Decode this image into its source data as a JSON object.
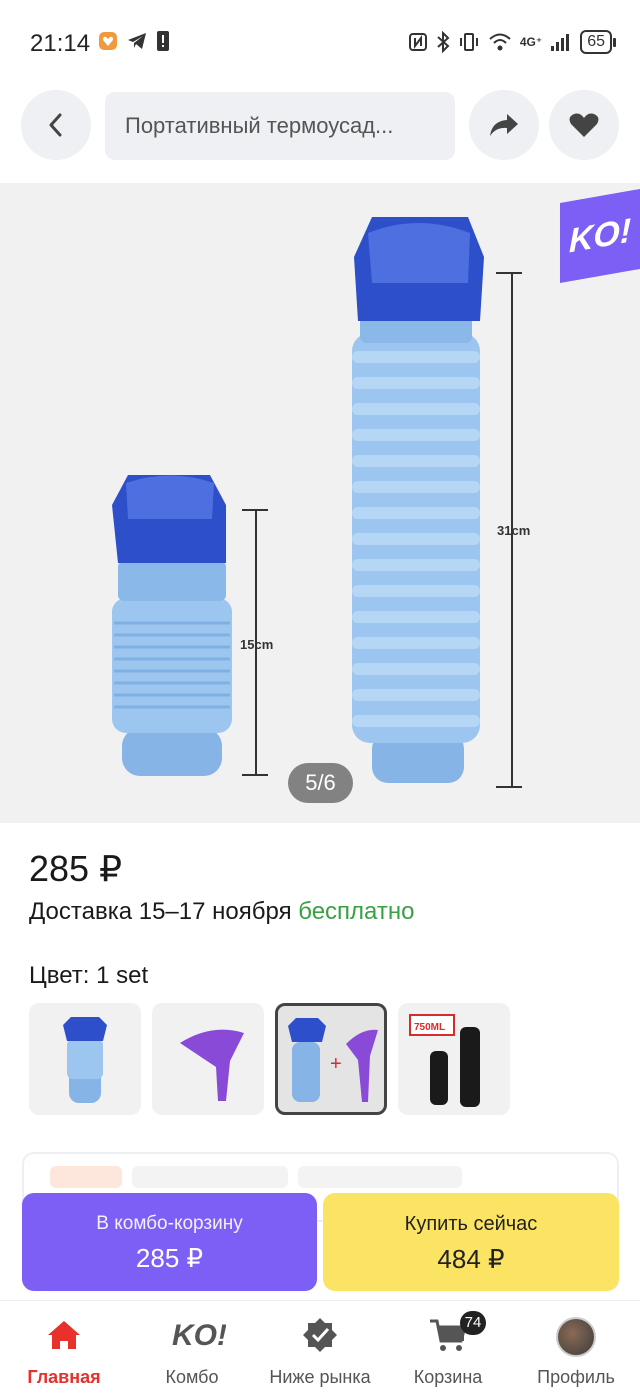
{
  "status_bar": {
    "time": "21:14",
    "battery": "65",
    "network": "4G⁺"
  },
  "header": {
    "search_text": "Портативный термоусад..."
  },
  "gallery": {
    "badge": "KO!",
    "page_indicator": "5/6",
    "label_short": "15cm",
    "label_tall": "31cm",
    "product_color": "#8ab8e8",
    "cap_color": "#2d4fc9"
  },
  "product": {
    "price": "285 ₽",
    "delivery_prefix": "Доставка 15–17 ноября",
    "delivery_free": "бесплатно",
    "color_label": "Цвет: 1 set"
  },
  "variants": [
    {
      "name": "bottle",
      "selected": false
    },
    {
      "name": "funnel",
      "selected": false
    },
    {
      "name": "bottle-plus-funnel",
      "selected": true
    },
    {
      "name": "black-750ml",
      "selected": false,
      "tag": "750ML"
    }
  ],
  "actions": {
    "combo_label": "В комбо-корзину",
    "combo_price": "285 ₽",
    "buy_label": "Купить сейчас",
    "buy_price": "484 ₽"
  },
  "bottom_nav": {
    "items": [
      {
        "label": "Главная",
        "icon": "home-icon",
        "active": true
      },
      {
        "label": "Комбо",
        "icon": "ko-icon",
        "active": false
      },
      {
        "label": "Ниже рынка",
        "icon": "check-badge-icon",
        "active": false
      },
      {
        "label": "Корзина",
        "icon": "cart-icon",
        "active": false,
        "badge": "74"
      },
      {
        "label": "Профиль",
        "icon": "avatar",
        "active": false
      }
    ]
  },
  "colors": {
    "accent_purple": "#7e5ff5",
    "buy_yellow": "#fbe364",
    "active_red": "#e7312a",
    "free_green": "#3aa142"
  }
}
